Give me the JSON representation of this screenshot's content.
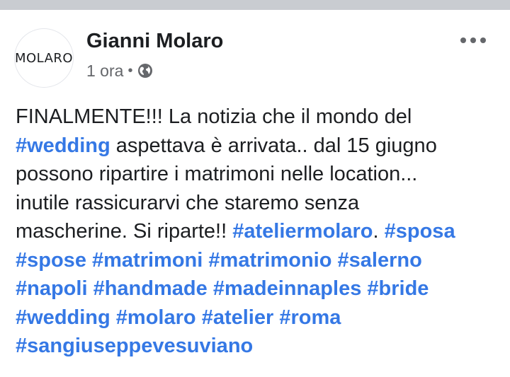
{
  "post": {
    "avatar_text": "MOLARO",
    "author": "Gianni Molaro",
    "time": "1 ora",
    "separator": "•",
    "privacy_icon": "globe-icon",
    "more_icon": "more-options-icon",
    "lines": [
      [
        "FINALMENTE!!! La notizia che il mondo del"
      ],
      [
        "#wedding",
        " aspettava è arrivata.. dal 15 giugno"
      ],
      [
        "possono ripartire i matrimoni nelle location..."
      ],
      [
        "inutile rassicurarvi che staremo senza"
      ],
      [
        "mascherine. Si riparte!! ",
        "#ateliermolaro",
        ". ",
        "#sposa"
      ],
      [
        "#spose",
        " ",
        "#matrimoni",
        " ",
        "#matrimonio",
        " ",
        "#salerno"
      ],
      [
        "#napoli",
        " ",
        "#handmade",
        " ",
        "#madeinnaples",
        " ",
        "#bride"
      ],
      [
        "#wedding",
        " ",
        "#molaro",
        " ",
        "#atelier",
        " ",
        "#roma"
      ],
      [
        "#sangiuseppevesuviano"
      ]
    ]
  },
  "colors": {
    "hashtag": "#3578e5",
    "text": "#1c1e21",
    "meta": "#65676b",
    "top_strip": "#c9ccd1"
  }
}
